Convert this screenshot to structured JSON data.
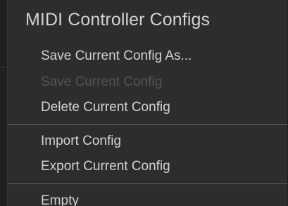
{
  "menu": {
    "title": "MIDI Controller Configs",
    "items": [
      {
        "label": "Save Current Config As...",
        "enabled": true
      },
      {
        "label": "Save Current Config",
        "enabled": false
      },
      {
        "label": "Delete Current Config",
        "enabled": true
      },
      {
        "label": "Import Config",
        "enabled": true
      },
      {
        "label": "Export Current Config",
        "enabled": true
      },
      {
        "label": "Empty",
        "enabled": true
      }
    ]
  },
  "colors": {
    "menu_background": "#2d2d2d",
    "text": "#d2d2d2",
    "disabled_text": "#545454",
    "separator": "#6a6a6a"
  }
}
